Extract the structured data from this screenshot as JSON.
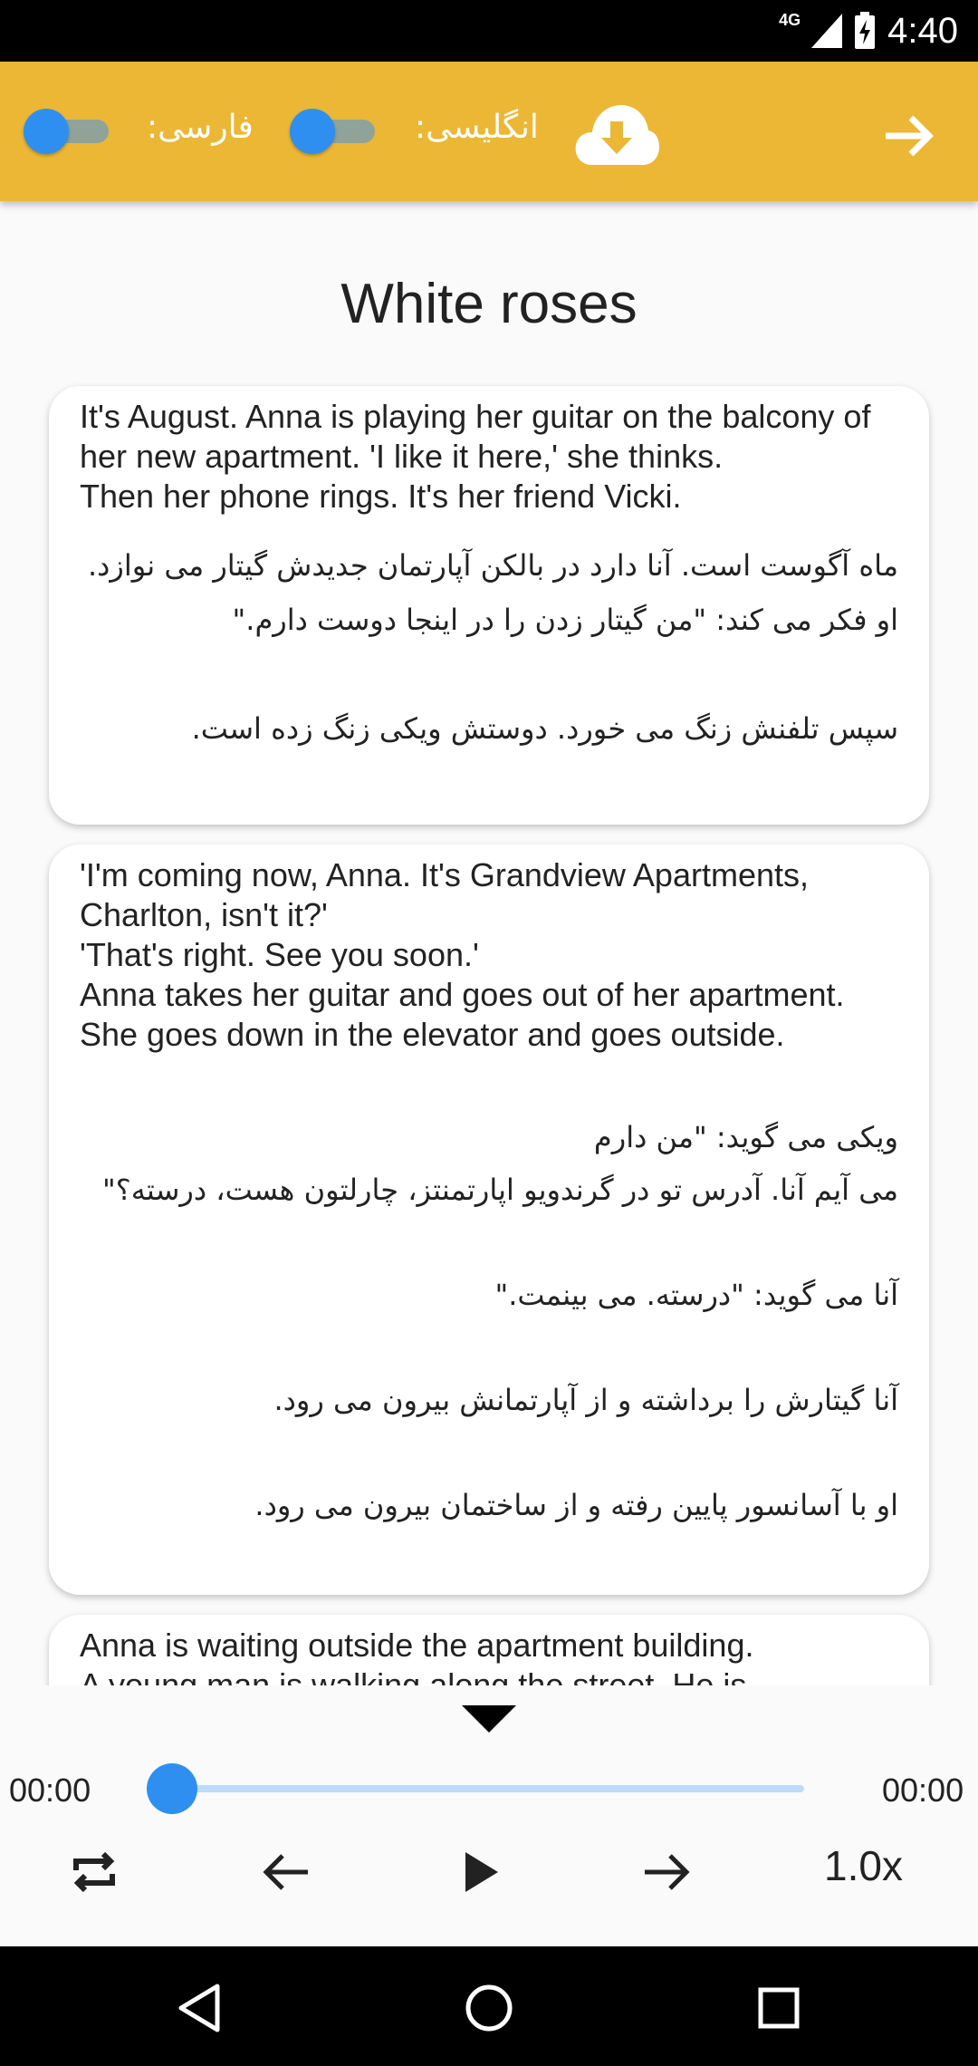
{
  "status_bar": {
    "network": "4G",
    "time": "4:40"
  },
  "app_bar": {
    "farsi_label": "فارسی:",
    "english_label": "انگلیسی:",
    "farsi_toggle_on": false,
    "english_toggle_on": false,
    "download_icon": "cloud-download-icon",
    "forward_icon": "arrow-forward-icon"
  },
  "story": {
    "title": "White roses",
    "cards": [
      {
        "en": "It's August. Anna is playing her guitar on the balcony of\nher new apartment. 'I like it here,' she thinks.\nThen her phone rings. It's her friend Vicki.",
        "fa": "ماه آگوست است. آنا دارد در بالکن آپارتمان جدیدش گیتار می نوازد. او فکر می کند: \"من گیتار زدن را در اینجا دوست دارم.\"\n\nسپس تلفنش زنگ می خورد. دوستش ویکی زنگ زده است."
      },
      {
        "en": "'I'm coming now, Anna. It's Grandview Apartments, Charlton, isn't it?'\n'That's right. See you soon.'\nAnna takes her guitar and goes out of her apartment.\nShe goes down in the elevator and goes outside.",
        "fa": "ویکی می گوید: \"من دارم\nمی آیم آنا. آدرس تو در گرندویو اپارتمنتز، چارلتون هست، درسته؟\"\n\nآنا می گوید: \"درسته. می بینمت.\"\n\nآنا گیتارش را برداشته و از آپارتمانش بیرون می رود.\n\nاو با آسانسور پایین رفته و از ساختمان بیرون می رود."
      },
      {
        "en": "Anna is waiting outside the apartment building.\nA young man is walking along the street. He is",
        "fa": ""
      }
    ]
  },
  "player": {
    "current_time": "00:00",
    "total_time": "00:00",
    "progress": 0,
    "speed": "1.0x",
    "icons": [
      "chevron-down-icon",
      "repeat-icon",
      "previous-icon",
      "play-icon",
      "next-icon"
    ]
  },
  "nav_bar": {
    "icons": [
      "back-icon",
      "home-icon",
      "recents-icon"
    ]
  },
  "colors": {
    "accent": "#ebb735",
    "primary": "#2e8ff0",
    "track": "#bcdcf7"
  }
}
